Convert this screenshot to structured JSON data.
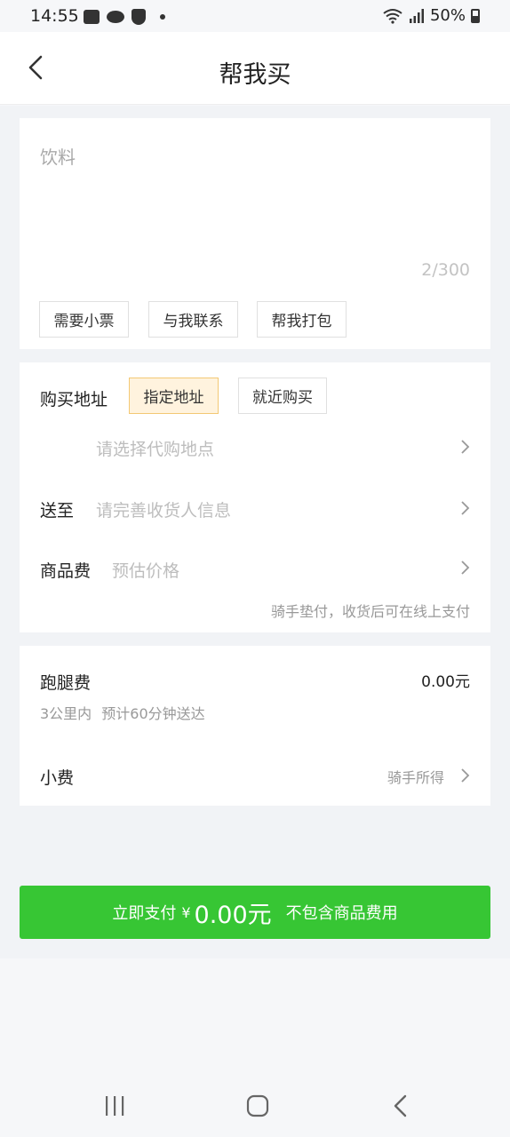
{
  "status_bar": {
    "time": "14:55",
    "battery": "50%"
  },
  "header": {
    "title": "帮我买"
  },
  "order": {
    "description": "饮料",
    "counter": "2/300",
    "tags": [
      "需要小票",
      "与我联系",
      "帮我打包"
    ]
  },
  "purchase": {
    "address_label": "购买地址",
    "options": [
      "指定地址",
      "就近购买"
    ],
    "selected_option": "指定地址",
    "location_placeholder": "请选择代购地点",
    "deliver_label": "送至",
    "deliver_placeholder": "请完善收货人信息",
    "goods_fee_label": "商品费",
    "goods_fee_placeholder": "预估价格",
    "note": "骑手垫付，收货后可在线上支付"
  },
  "fees": {
    "errand_label": "跑腿费",
    "errand_amount": "0.00元",
    "distance": "3公里内",
    "eta": "预计60分钟送达",
    "tip_label": "小费",
    "tip_note": "骑手所得"
  },
  "pay": {
    "label": "立即支付",
    "currency": "¥",
    "amount": "0.00元",
    "note": "不包含商品费用"
  }
}
